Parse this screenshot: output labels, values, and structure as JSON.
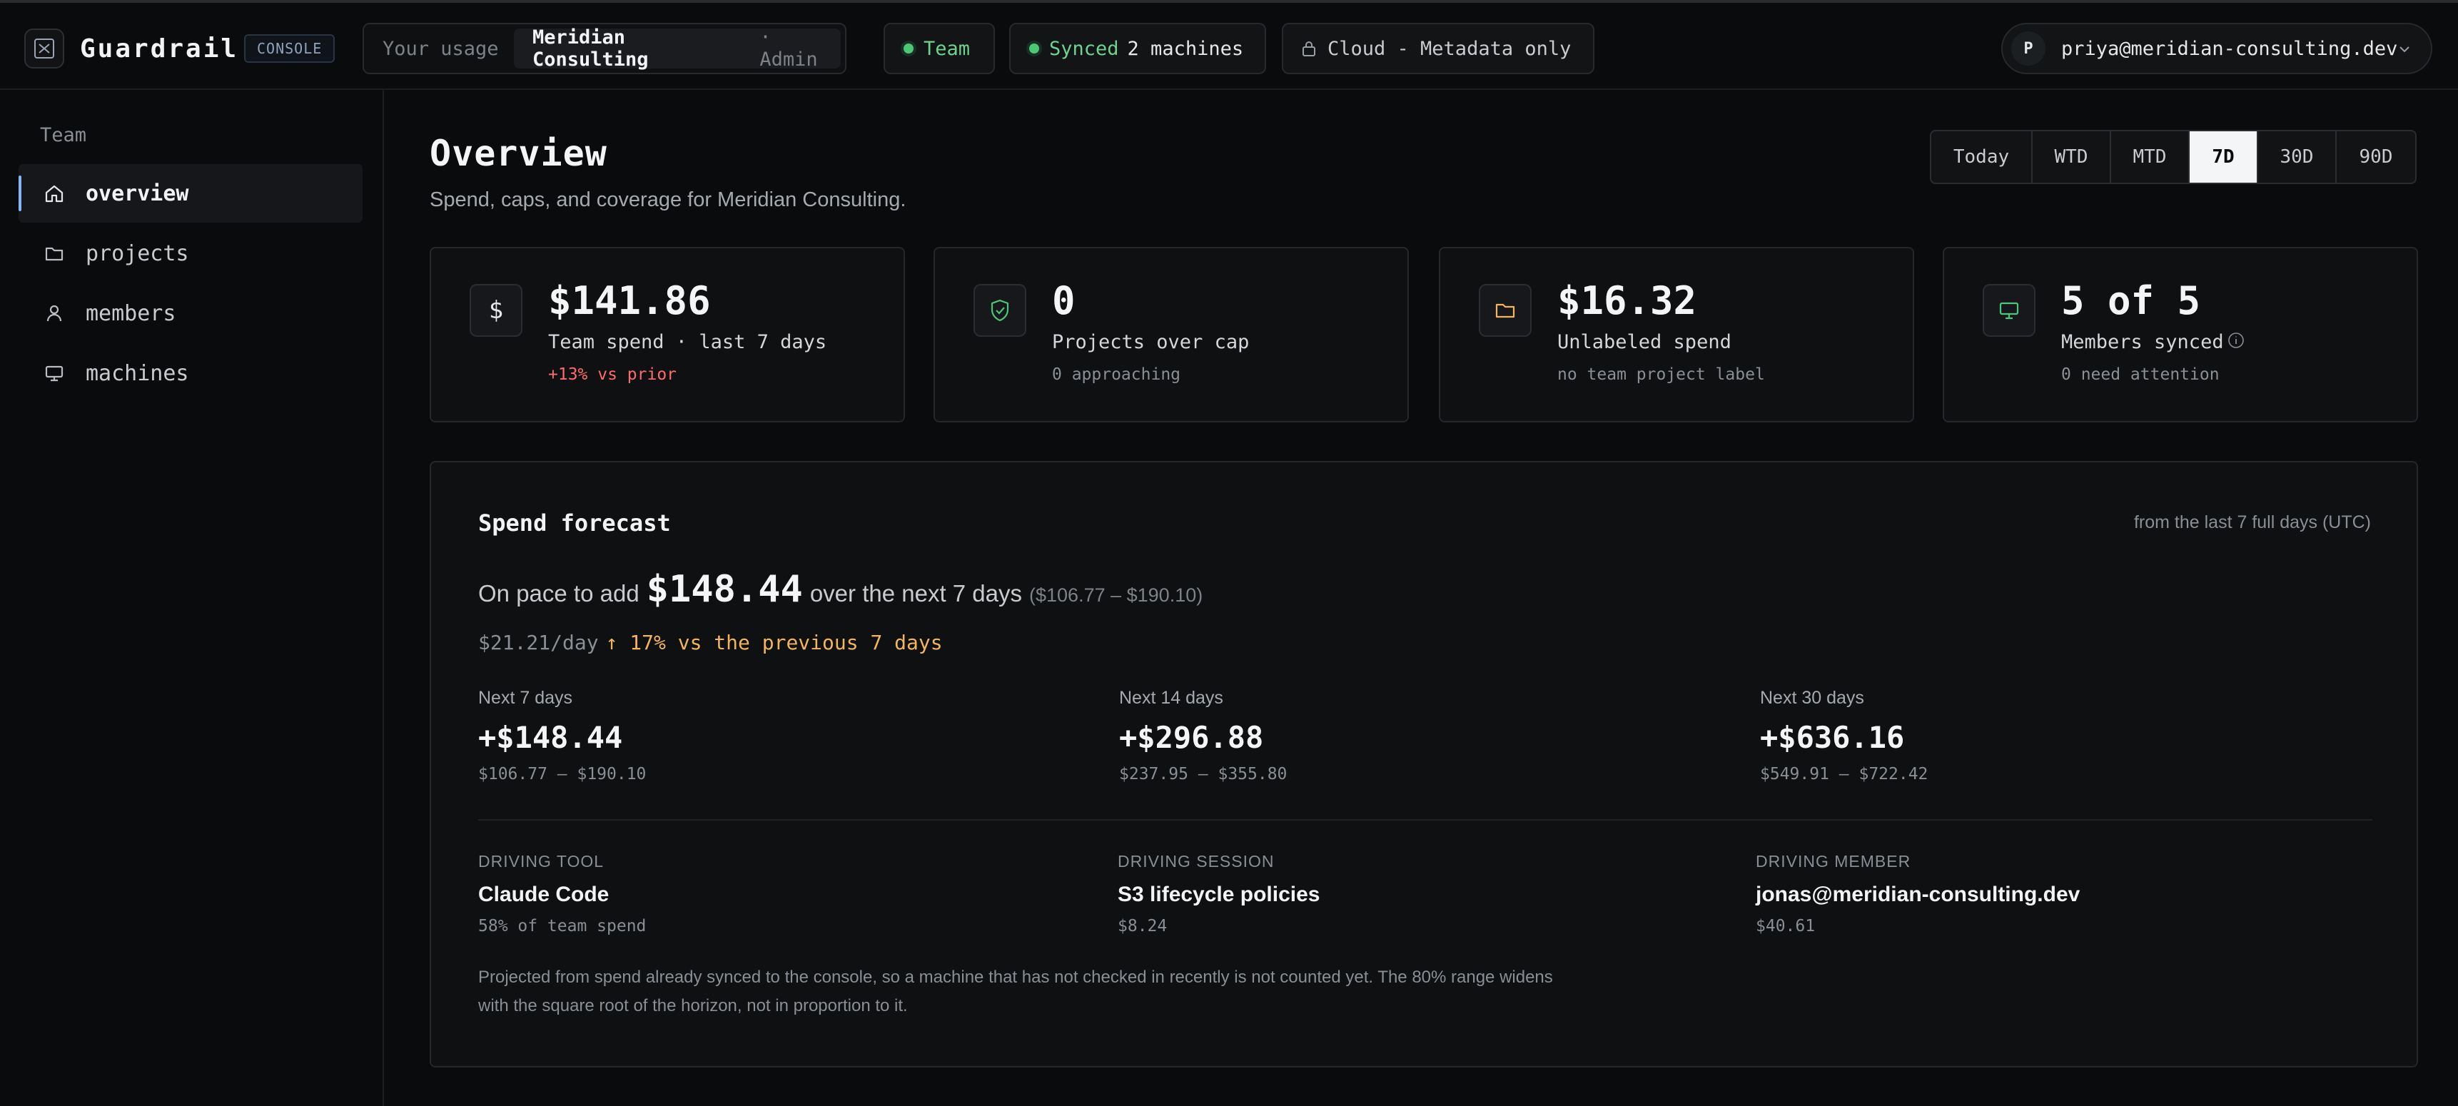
{
  "header": {
    "brand": "Guardrail",
    "badge": "CONSOLE",
    "usage_label": "Your usage",
    "org": "Meridian Consulting",
    "role": "· Admin",
    "team_pill": "Team",
    "sync_status": "Synced",
    "sync_detail": "2 machines",
    "cloud_mode": "Cloud - Metadata only",
    "user_initial": "P",
    "user_email": "priya@meridian-consulting.dev"
  },
  "sidebar": {
    "heading": "Team",
    "items": [
      {
        "label": "overview",
        "icon": "home-icon",
        "active": true
      },
      {
        "label": "projects",
        "icon": "folder-icon",
        "active": false
      },
      {
        "label": "members",
        "icon": "user-icon",
        "active": false
      },
      {
        "label": "machines",
        "icon": "monitor-icon",
        "active": false
      }
    ]
  },
  "main": {
    "title": "Overview",
    "subtitle": "Spend, caps, and coverage for Meridian Consulting.",
    "ranges": [
      "Today",
      "WTD",
      "MTD",
      "7D",
      "30D",
      "90D"
    ],
    "selected_range": "7D"
  },
  "cards": [
    {
      "icon": "dollar-icon",
      "value": "$141.86",
      "label": "Team spend · last 7 days",
      "sub": "+13% vs prior"
    },
    {
      "icon": "shield-check-icon",
      "value": "0",
      "label": "Projects over cap",
      "sub": "0 approaching"
    },
    {
      "icon": "folder-icon",
      "value": "$16.32",
      "label": "Unlabeled spend",
      "sub": "no team project label"
    },
    {
      "icon": "monitor-icon",
      "value": "5 of 5",
      "label": "Members synced",
      "sub": "0 need attention"
    }
  ],
  "forecast": {
    "title": "Spend forecast",
    "note": "from the last 7 full days (UTC)",
    "pace_prefix": "On pace to add",
    "pace_value": "$148.44",
    "pace_suffix": "over the next 7 days",
    "pace_band": "($106.77 – $190.10)",
    "rate": "$21.21/day",
    "rate_change": "↑ 17% vs the previous 7 days",
    "horizons": [
      {
        "label": "Next 7 days",
        "value": "+$148.44",
        "range": "$106.77 – $190.10"
      },
      {
        "label": "Next 14 days",
        "value": "+$296.88",
        "range": "$237.95 – $355.80"
      },
      {
        "label": "Next 30 days",
        "value": "+$636.16",
        "range": "$549.91 – $722.42"
      }
    ],
    "drivers": [
      {
        "label": "DRIVING TOOL",
        "value": "Claude Code",
        "sub": "58% of team spend"
      },
      {
        "label": "DRIVING SESSION",
        "value": "S3 lifecycle policies",
        "sub": "$8.24"
      },
      {
        "label": "DRIVING MEMBER",
        "value": "jonas@meridian-consulting.dev",
        "sub": "$40.61"
      }
    ],
    "footnote": "Projected from spend already synced to the console, so a machine that has not checked in recently is not counted yet. The 80% range widens with the square root of the horizon, not in proportion to it."
  },
  "colors": {
    "accent_green": "#4cc776",
    "negative_red": "#ff6b6b",
    "warning_amber": "#f3b55c"
  }
}
